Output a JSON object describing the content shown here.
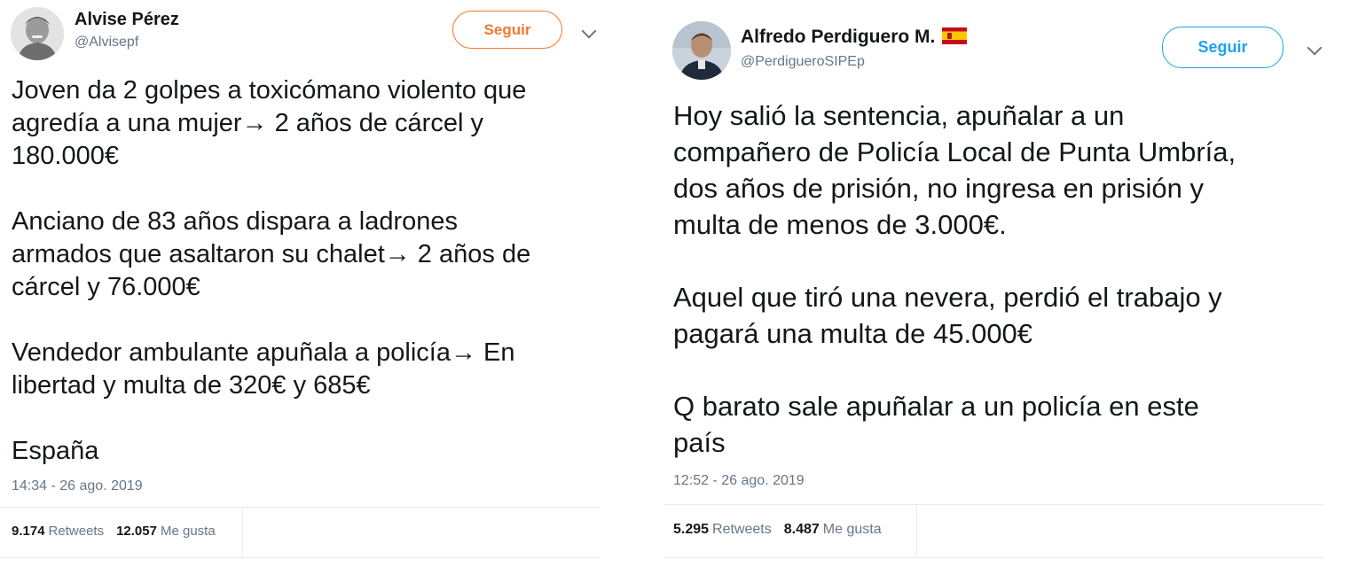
{
  "tweets": [
    {
      "name": "Alvise Pérez",
      "handle": "@Alvisepf",
      "follow_label": "Seguir",
      "text": "Joven da 2 golpes a toxicómano violento que\nagredía a una mujer→ 2 años de cárcel y\n180.000€\n\nAnciano de 83 años dispara a ladrones\narmados que asaltaron su chalet→ 2 años de\ncárcel y 76.000€\n\nVendedor ambulante apuñala a policía→ En\nlibertad y multa de 320€ y 685€\n\nEspaña",
      "timestamp": "14:34 - 26 ago. 2019",
      "retweets_count": "9.174",
      "retweets_label": "Retweets",
      "likes_count": "12.057",
      "likes_label": "Me gusta",
      "follow_color": "#f4782c"
    },
    {
      "name": "Alfredo Perdiguero M.",
      "handle": "@PerdigueroSIPEp",
      "follow_label": "Seguir",
      "text": "Hoy salió la sentencia, apuñalar a un\ncompañero de Policía Local de Punta Umbría,\ndos años de prisión, no ingresa en prisión y\nmulta de menos de 3.000€.\n\nAquel que tiró una nevera, perdió el trabajo y\npagará una multa de 45.000€\n\nQ barato sale apuñalar a un policía en este\npaís",
      "timestamp": "12:52 - 26 ago. 2019",
      "retweets_count": "5.295",
      "retweets_label": "Retweets",
      "likes_count": "8.487",
      "likes_label": "Me gusta",
      "follow_color": "#1da1f2"
    }
  ],
  "icons": {
    "chevron": "chevron-down-icon",
    "flag": "spain-flag-icon",
    "avatar": "avatar"
  }
}
